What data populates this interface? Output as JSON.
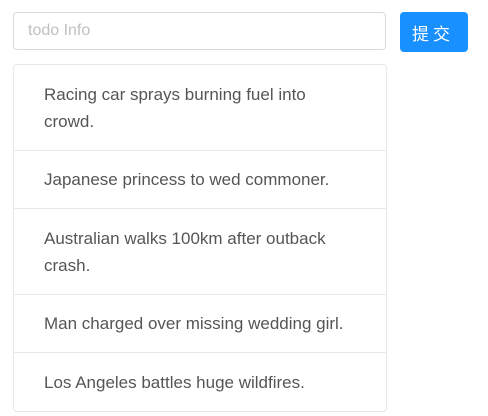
{
  "form": {
    "input_value": "",
    "input_placeholder": "todo Info",
    "submit_label": "提交",
    "submit_color": "#1890ff"
  },
  "todo_list": {
    "items": [
      {
        "text": "Racing car sprays burning fuel into crowd."
      },
      {
        "text": "Japanese princess to wed commoner."
      },
      {
        "text": "Australian walks 100km after outback crash."
      },
      {
        "text": "Man charged over missing wedding girl."
      },
      {
        "text": "Los Angeles battles huge wildfires."
      }
    ]
  }
}
